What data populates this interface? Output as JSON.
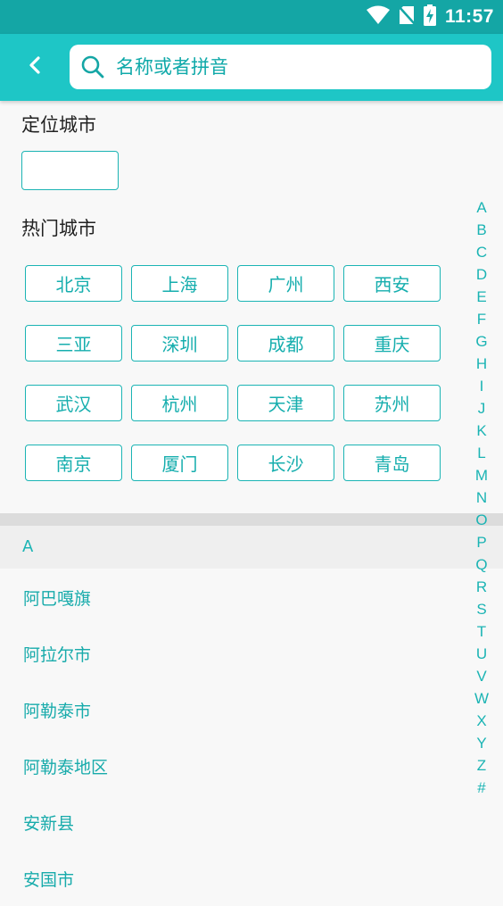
{
  "status_bar": {
    "time": "11:57",
    "icons": [
      "wifi-icon",
      "no-sim-icon",
      "battery-charging-icon"
    ]
  },
  "search": {
    "placeholder": "名称或者拼音",
    "value": ""
  },
  "locate_section": {
    "title": "定位城市",
    "current_city": ""
  },
  "hot_section": {
    "title": "热门城市",
    "cities": [
      "北京",
      "上海",
      "广州",
      "西安",
      "三亚",
      "深圳",
      "成都",
      "重庆",
      "武汉",
      "杭州",
      "天津",
      "苏州",
      "南京",
      "厦门",
      "长沙",
      "青岛"
    ]
  },
  "city_list": {
    "group_letter": "A",
    "cities": [
      "阿巴嘎旗",
      "阿拉尔市",
      "阿勒泰市",
      "阿勒泰地区",
      "安新县",
      "安国市"
    ]
  },
  "index_letters": [
    "A",
    "B",
    "C",
    "D",
    "E",
    "F",
    "G",
    "H",
    "I",
    "J",
    "K",
    "L",
    "M",
    "N",
    "O",
    "P",
    "Q",
    "R",
    "S",
    "T",
    "U",
    "V",
    "W",
    "X",
    "Y",
    "Z",
    "#"
  ],
  "colors": {
    "status_bar": "#14a6a5",
    "app_bar": "#1ec6c6",
    "accent": "#1bb4b4"
  }
}
